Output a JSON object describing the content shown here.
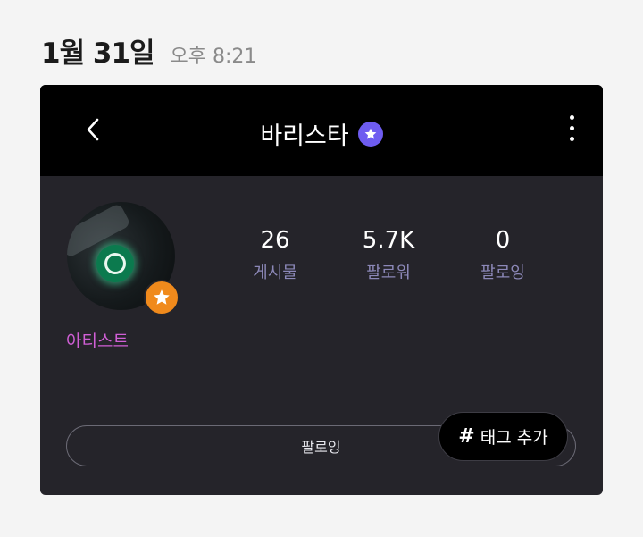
{
  "header": {
    "date": "1월 31일",
    "time": "오후 8:21"
  },
  "profile": {
    "title": "바리스타",
    "role_label": "아티스트",
    "stats": [
      {
        "value": "26",
        "label": "게시물"
      },
      {
        "value": "5.7K",
        "label": "팔로워"
      },
      {
        "value": "0",
        "label": "팔로잉"
      }
    ],
    "follow_button": "팔로잉",
    "tag_button": {
      "symbol": "#",
      "label": "태그 추가"
    }
  },
  "colors": {
    "verify_badge": "#6e5cf0",
    "artist_badge": "#f08a1c",
    "artist_label": "#d15fd6",
    "stat_label": "#8c88b8",
    "card_bg": "#25242a",
    "topbar_bg": "#000000"
  },
  "icons": {
    "back": "chevron-left-icon",
    "verify": "star-badge-icon",
    "menu": "more-vertical-icon",
    "artist": "star-icon"
  }
}
